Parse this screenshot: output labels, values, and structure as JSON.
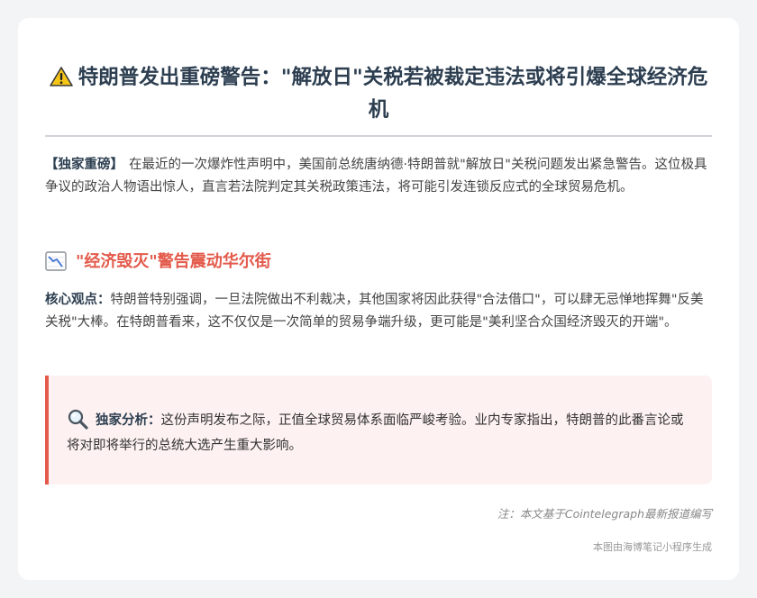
{
  "article": {
    "title": "特朗普发出重磅警告：\"解放日\"关税若被裁定违法或将引爆全球经济危机",
    "intro_tag": "【独家重磅】",
    "intro_text": "在最近的一次爆炸性声明中，美国前总统唐纳德·特朗普就\"解放日\"关税问题发出紧急警告。这位极具争议的政治人物语出惊人，直言若法院判定其关税政策违法，将可能引发连锁反应式的全球贸易危机。",
    "section_heading": "\"经济毁灭\"警告震动华尔街",
    "core_label": "核心观点：",
    "core_text": "特朗普特别强调，一旦法院做出不利裁决，其他国家将因此获得\"合法借口\"，可以肆无忌惮地挥舞\"反美关税\"大棒。在特朗普看来，这不仅仅是一次简单的贸易争端升级，更可能是\"美利坚合众国经济毁灭的开端\"。",
    "analysis_label": "独家分析：",
    "analysis_text": "这份声明发布之际，正值全球贸易体系面临严峻考验。业内专家指出，特朗普的此番言论或将对即将举行的总统大选产生重大影响。",
    "note": "注：本文基于Cointelegraph最新报道编写",
    "footer": "本图由海博笔记小程序生成"
  },
  "icons": {
    "title_icon": "warning-icon",
    "section_icon": "chart-decreasing-icon",
    "analysis_icon": "magnifier-icon"
  },
  "colors": {
    "accent": "#e35a4b",
    "heading": "#2c3e50",
    "callout_bg": "#fdf1f1"
  }
}
